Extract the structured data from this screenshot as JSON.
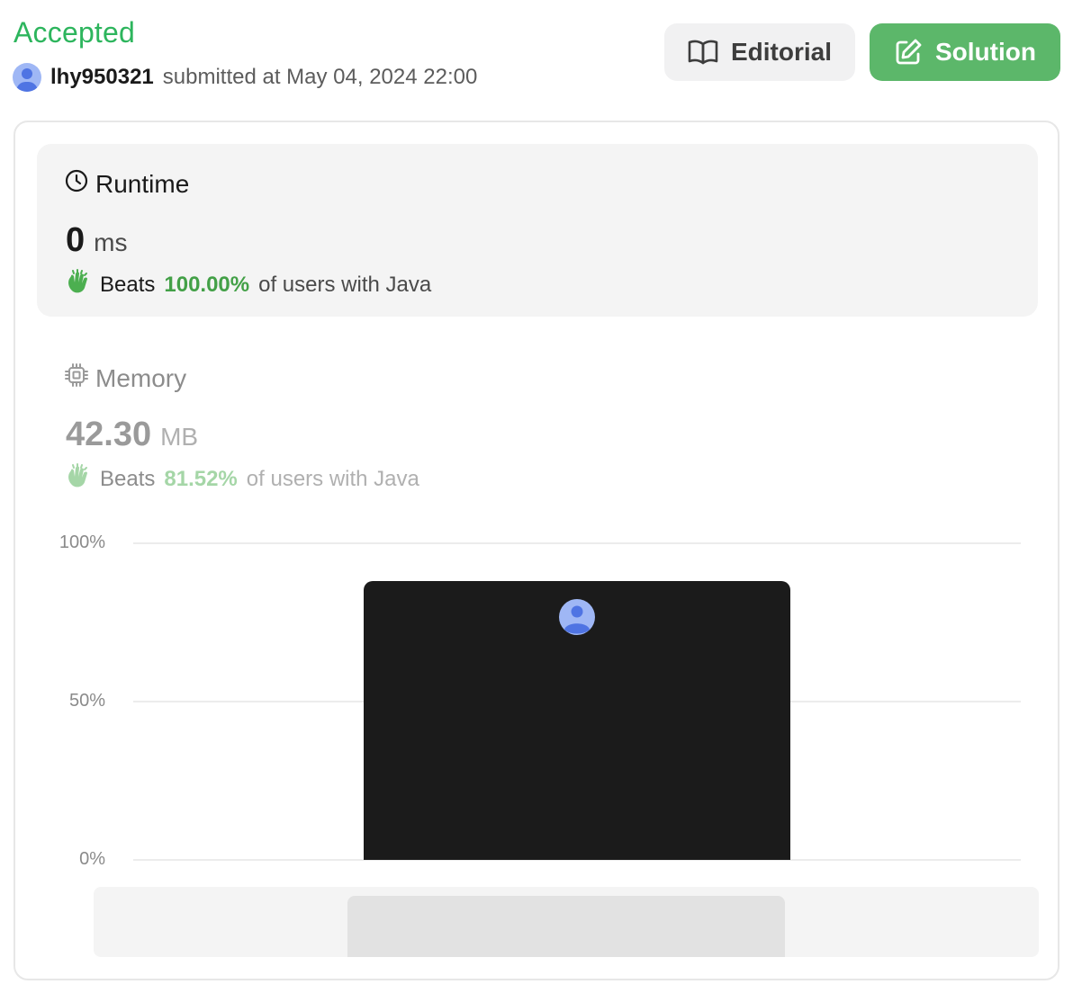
{
  "submission": {
    "status": "Accepted",
    "username": "lhy950321",
    "submitted_text": "submitted at May 04, 2024 22:00"
  },
  "buttons": {
    "editorial": "Editorial",
    "solution": "Solution"
  },
  "runtime": {
    "title": "Runtime",
    "value": "0",
    "unit": "ms",
    "beats_label": "Beats",
    "beats_pct": "100.00%",
    "beats_suffix": "of users with Java"
  },
  "memory": {
    "title": "Memory",
    "value": "42.30",
    "unit": "MB",
    "beats_label": "Beats",
    "beats_pct": "81.52%",
    "beats_suffix": "of users with Java"
  },
  "colors": {
    "accent_green": "#2db55d",
    "beats_green": "#43a047",
    "solution_button": "#5cb76a",
    "bar": "#1b1b1b"
  },
  "icons": {
    "editorial": "book-open-icon",
    "solution": "edit-icon",
    "runtime": "clock-icon",
    "memory": "cpu-icon",
    "beats": "clap-hands-icon"
  },
  "chart_data": {
    "type": "bar",
    "ytick_labels": [
      "100%",
      "50%",
      "0%"
    ],
    "ylim": [
      0,
      100
    ],
    "bars": [
      {
        "value": 88,
        "highlight": true
      }
    ]
  }
}
